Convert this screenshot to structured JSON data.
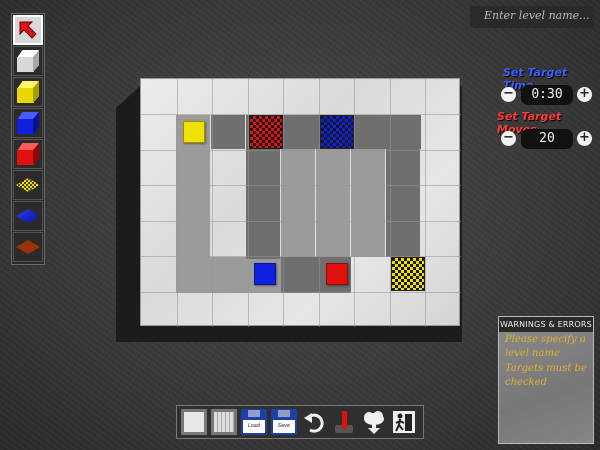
{
  "level_name": {
    "placeholder": "Enter level name..."
  },
  "palette": {
    "tools": [
      {
        "name": "arrow-tool",
        "icon": "cursor-arrow-icon",
        "selected": true
      },
      {
        "name": "white-cube-tool",
        "icon": "white-cube-icon",
        "color": "#e8e8e8"
      },
      {
        "name": "yellow-cube-tool",
        "icon": "yellow-cube-icon",
        "color": "#f0e000"
      },
      {
        "name": "blue-cube-tool",
        "icon": "blue-cube-icon",
        "color": "#1020e0"
      },
      {
        "name": "red-cube-tool",
        "icon": "red-cube-icon",
        "color": "#e01010"
      },
      {
        "name": "yellow-target-tool",
        "icon": "yellow-target-icon",
        "color": "#f0e000"
      },
      {
        "name": "blue-target-tool",
        "icon": "blue-target-icon",
        "color": "#1020e0"
      },
      {
        "name": "red-target-tool",
        "icon": "red-target-icon",
        "color": "#e01010"
      }
    ]
  },
  "settings": {
    "time": {
      "label": "Set Target Time",
      "value": "0:30",
      "minus": "−",
      "plus": "+",
      "color": "#3f5fff"
    },
    "moves": {
      "label": "Set Target Moves",
      "value": "20",
      "minus": "−",
      "plus": "+",
      "color": "#ff3b3b"
    }
  },
  "board": {
    "columns": 9,
    "rows": 7,
    "blocks": [
      {
        "name": "yellow-block",
        "color": "#f0e000",
        "col": 1,
        "row": 1
      },
      {
        "name": "blue-block",
        "color": "#1020e0",
        "col": 3,
        "row": 5
      },
      {
        "name": "red-block",
        "color": "#e01010",
        "col": 5,
        "row": 5
      }
    ],
    "targets": [
      {
        "name": "red-target",
        "color": "#e01010",
        "col": 3,
        "row": 1
      },
      {
        "name": "blue-target",
        "color": "#1020e0",
        "col": 5,
        "row": 1
      },
      {
        "name": "yellow-target",
        "color": "#f0e000",
        "col": 7,
        "row": 5
      }
    ]
  },
  "warnings": {
    "title": "WARNINGS & ERRORS",
    "items": [
      "Please specify a level name",
      "Targets must be checked"
    ]
  },
  "toolbar": {
    "buttons": [
      {
        "name": "wall-frame-button",
        "icon": "wall-frame-icon"
      },
      {
        "name": "grid-frame-button",
        "icon": "grid-frame-icon"
      },
      {
        "name": "load-button",
        "icon": "floppy-disk-icon",
        "label": "Load"
      },
      {
        "name": "save-button",
        "icon": "floppy-disk-icon",
        "label": "Save"
      },
      {
        "name": "undo-button",
        "icon": "undo-arrow-icon"
      },
      {
        "name": "test-play-button",
        "icon": "joystick-icon"
      },
      {
        "name": "upload-button",
        "icon": "cloud-upload-icon"
      },
      {
        "name": "exit-button",
        "icon": "exit-door-icon"
      }
    ]
  }
}
